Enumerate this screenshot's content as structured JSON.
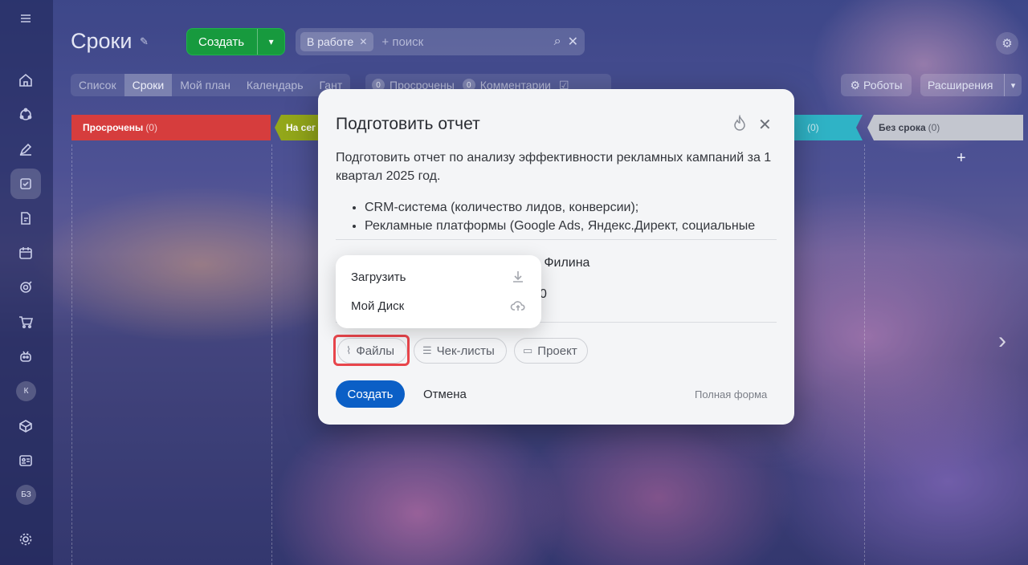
{
  "header": {
    "title": "Сроки",
    "create_label": "Создать",
    "filter_chip": "В работе",
    "search_placeholder": "+ поиск"
  },
  "views": [
    "Список",
    "Сроки",
    "Мой план",
    "Календарь",
    "Гант"
  ],
  "counters": [
    {
      "count": "0",
      "label": "Просрочены"
    },
    {
      "count": "0",
      "label": "Комментарии"
    }
  ],
  "toolbar": {
    "robots": "Роботы",
    "extensions": "Расширения"
  },
  "rail": {
    "avatar_k": "К",
    "avatar_bz": "БЗ"
  },
  "columns": [
    {
      "title": "Просрочены",
      "count": "(0)"
    },
    {
      "title": "На сег",
      "count": ""
    },
    {
      "title": "",
      "count": "(0)"
    },
    {
      "title": "Без срока",
      "count": "(0)"
    }
  ],
  "modal": {
    "title": "Подготовить отчет",
    "description": "Подготовить отчет по анализу эффективности рекламных кампаний за 1 квартал 2025 год.",
    "bullets": [
      "CRM-система (количество лидов, конверсии);",
      "Рекламные платформы (Google Ads, Яндекс.Директ, социальные сети)"
    ],
    "assignee_fragment": "а Филина",
    "deadline_fragment": "0",
    "chips": {
      "files": "Файлы",
      "checklists": "Чек-листы",
      "project": "Проект"
    },
    "create_button": "Создать",
    "cancel_button": "Отмена",
    "full_form": "Полная форма"
  },
  "menu": {
    "upload": "Загрузить",
    "disk": "Мой Диск"
  },
  "colors": {
    "green": "#179a3e",
    "overdue": "#d63d3d",
    "today": "#93a71a",
    "teal": "#2fb3c6",
    "primary": "#0b5fc6",
    "highlight": "#e8454b"
  }
}
